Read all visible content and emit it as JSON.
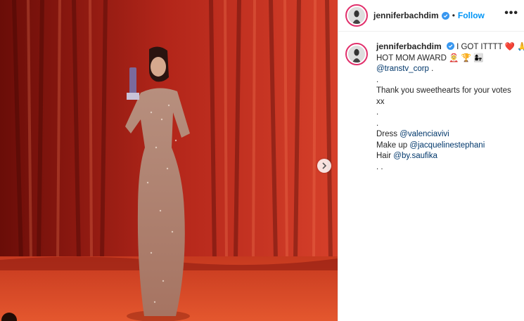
{
  "post": {
    "username": "jenniferbachdim",
    "follow_label": "Follow",
    "separator": "•",
    "more_label": "•••",
    "caption": {
      "line1_text": "I GOT ITTTT ❤️ 🙏",
      "line2_text": "HOT MOM AWARD 🤶 🏆 👩‍👧",
      "mention_corp": "@transtv_corp",
      "mention_corp_suffix": " .",
      "dot1": ".",
      "thanks": "Thank you sweethearts for your votes",
      "xx": "xx",
      "dot2": ".",
      "dot3": ".",
      "dress_label": "Dress ",
      "dress_mention": "@valenciavivi",
      "makeup_label": "Make up ",
      "makeup_mention": "@jacquelinestephani",
      "hair_label": "Hair ",
      "hair_mention": "@by.saufika",
      "trailing_dots": ". ."
    }
  },
  "colors": {
    "accent_blue": "#0095f6",
    "mention_blue": "#00376b",
    "story_ring": "#e1306c",
    "verified_blue": "#3897f0"
  },
  "icons": {
    "next": "chevron-right-icon",
    "verified": "verified-badge-icon",
    "tag": "user-tag-icon"
  }
}
